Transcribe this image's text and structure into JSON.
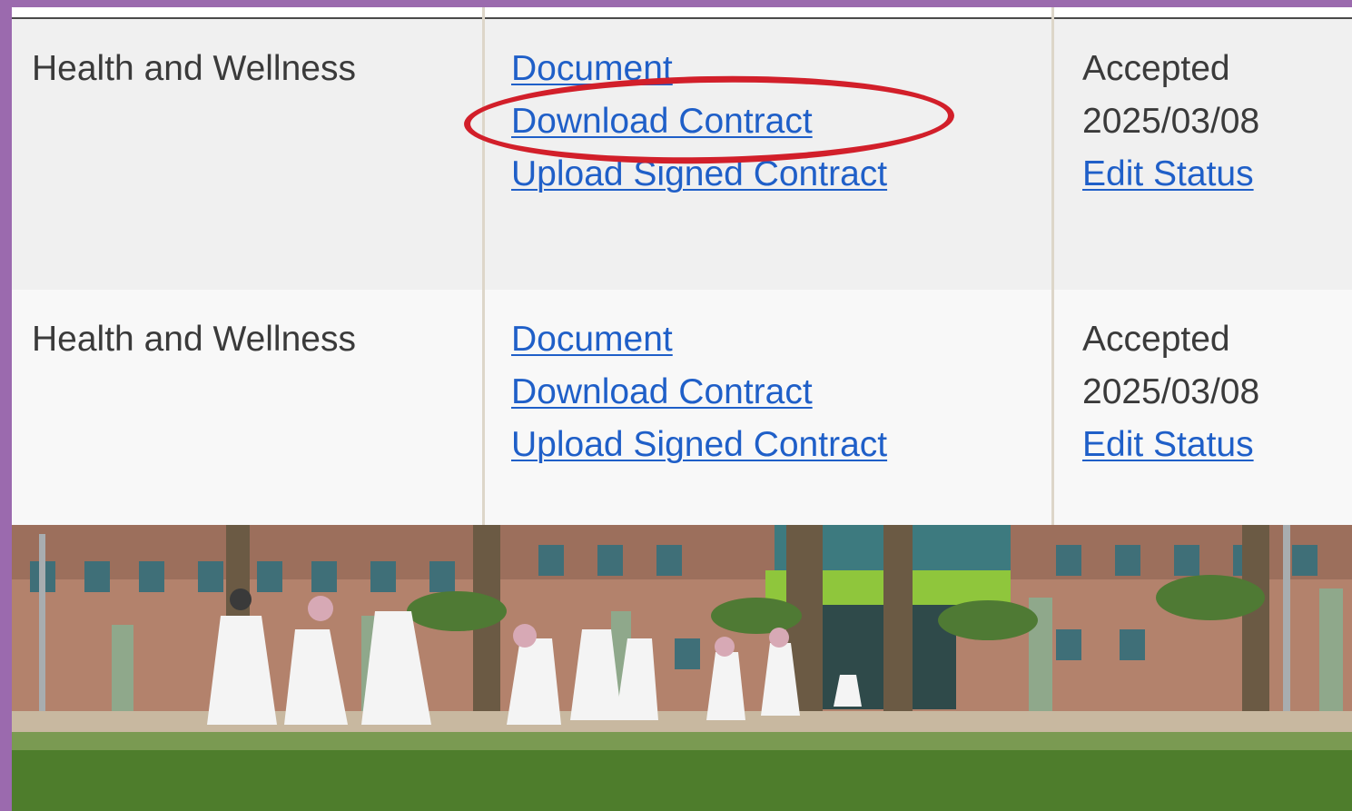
{
  "table": {
    "rows": [
      {
        "category": "Health and Wellness",
        "links": {
          "document": "Document",
          "download_contract": "Download Contract",
          "upload_signed_contract": "Upload Signed Contract"
        },
        "status": {
          "state": "Accepted",
          "date": "2025/03/08",
          "edit_label": "Edit Status"
        }
      },
      {
        "category": "Health and Wellness",
        "links": {
          "document": "Document",
          "download_contract": "Download Contract",
          "upload_signed_contract": "Upload Signed Contract"
        },
        "status": {
          "state": "Accepted",
          "date": "2025/03/08",
          "edit_label": "Edit Status"
        }
      }
    ]
  },
  "annotation": {
    "color": "#d21f2a",
    "target": "download-contract-link-row-1"
  },
  "colors": {
    "link": "#1f5fc8",
    "frame": "#9b6aae",
    "row_odd": "#f0f0f0",
    "row_even": "#f8f8f8"
  }
}
